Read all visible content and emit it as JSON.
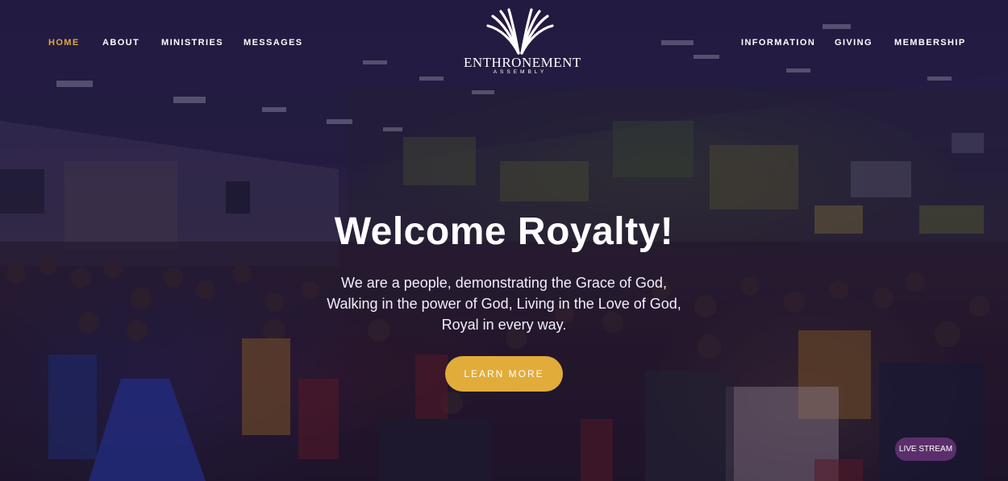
{
  "nav": {
    "left": [
      "HOME",
      "ABOUT",
      "MINISTRIES",
      "MESSAGES"
    ],
    "right": [
      "INFORMATION",
      "GIVING",
      "MEMBERSHIP"
    ],
    "active": "HOME"
  },
  "logo": {
    "title": "ENTHRONEMENT",
    "subtitle": "ASSEMBLY",
    "icon": "wings-icon"
  },
  "hero": {
    "headline": "Welcome Royalty!",
    "tagline": [
      "We are a people, demonstrating the Grace of God,",
      "Walking in the power of God, Living in the Love of God,",
      "Royal in every way."
    ],
    "cta_label": "LEARN MORE",
    "background": "worship-crowd-photo"
  },
  "live_stream": {
    "label": "LIVE STREAM"
  },
  "colors": {
    "accent": "#e2ac3b",
    "active_nav": "#e0a93c",
    "overlay": "#140c32",
    "live_badge": "#5b2f6b"
  }
}
